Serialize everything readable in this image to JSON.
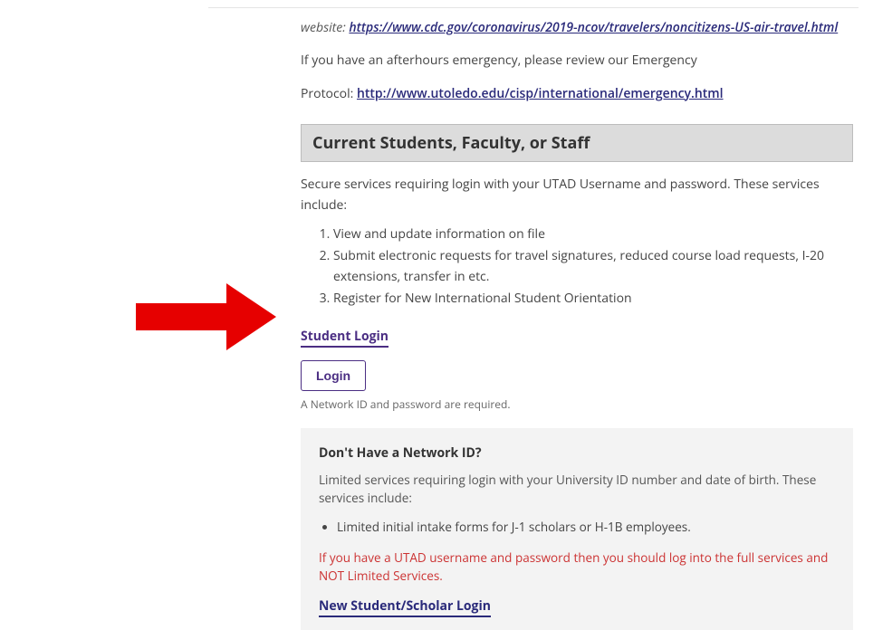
{
  "intro": {
    "website_label": "website:",
    "website_url": "https://www.cdc.gov/coronavirus/2019-ncov/travelers/noncitizens-US-air-travel.html",
    "afterhours_text": "If you have an afterhours emergency, please review our Emergency",
    "protocol_label": "Protocol:",
    "protocol_url": "http://www.utoledo.edu/cisp/international/emergency.html"
  },
  "section": {
    "header": "Current Students, Faculty, or Staff",
    "desc": "Secure services requiring login with your UTAD Username and password. These services include:",
    "services": [
      "View and update information on file",
      "Submit electronic requests for travel signatures, reduced course load requests, I-20 extensions, transfer in etc.",
      "Register for New International Student Orientation"
    ],
    "student_login_label": "Student Login",
    "login_button": "Login",
    "hint": "A Network ID and password are required."
  },
  "no_id_box": {
    "heading": "Don't Have a Network ID?",
    "desc": "Limited services requiring login with your University ID number and date of birth. These services include:",
    "bullets": [
      "Limited initial intake forms for J-1 scholars or H-1B employees."
    ],
    "warning": "If you have a UTAD username and password then you should log into the full services and NOT Limited Services.",
    "new_login_label": "New Student/Scholar Login"
  }
}
